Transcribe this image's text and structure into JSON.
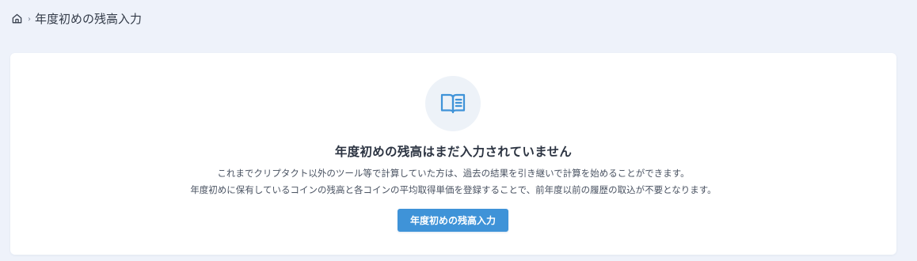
{
  "breadcrumb": {
    "home_icon": "home-icon",
    "separator": "›",
    "current": "年度初めの残高入力"
  },
  "empty_state": {
    "icon": "book-icon",
    "title": "年度初めの残高はまだ入力されていません",
    "description_line1": "これまでクリプタクト以外のツール等で計算していた方は、過去の結果を引き継いで計算を始めることができます。",
    "description_line2": "年度初めに保有しているコインの残高と各コインの平均取得単価を登録することで、前年度以前の履歴の取込が不要となります。",
    "button_label": "年度初めの残高入力"
  },
  "colors": {
    "page_background": "#eef2fa",
    "card_background": "#ffffff",
    "accent": "#3f93d8",
    "icon_circle": "#edf2f8"
  }
}
